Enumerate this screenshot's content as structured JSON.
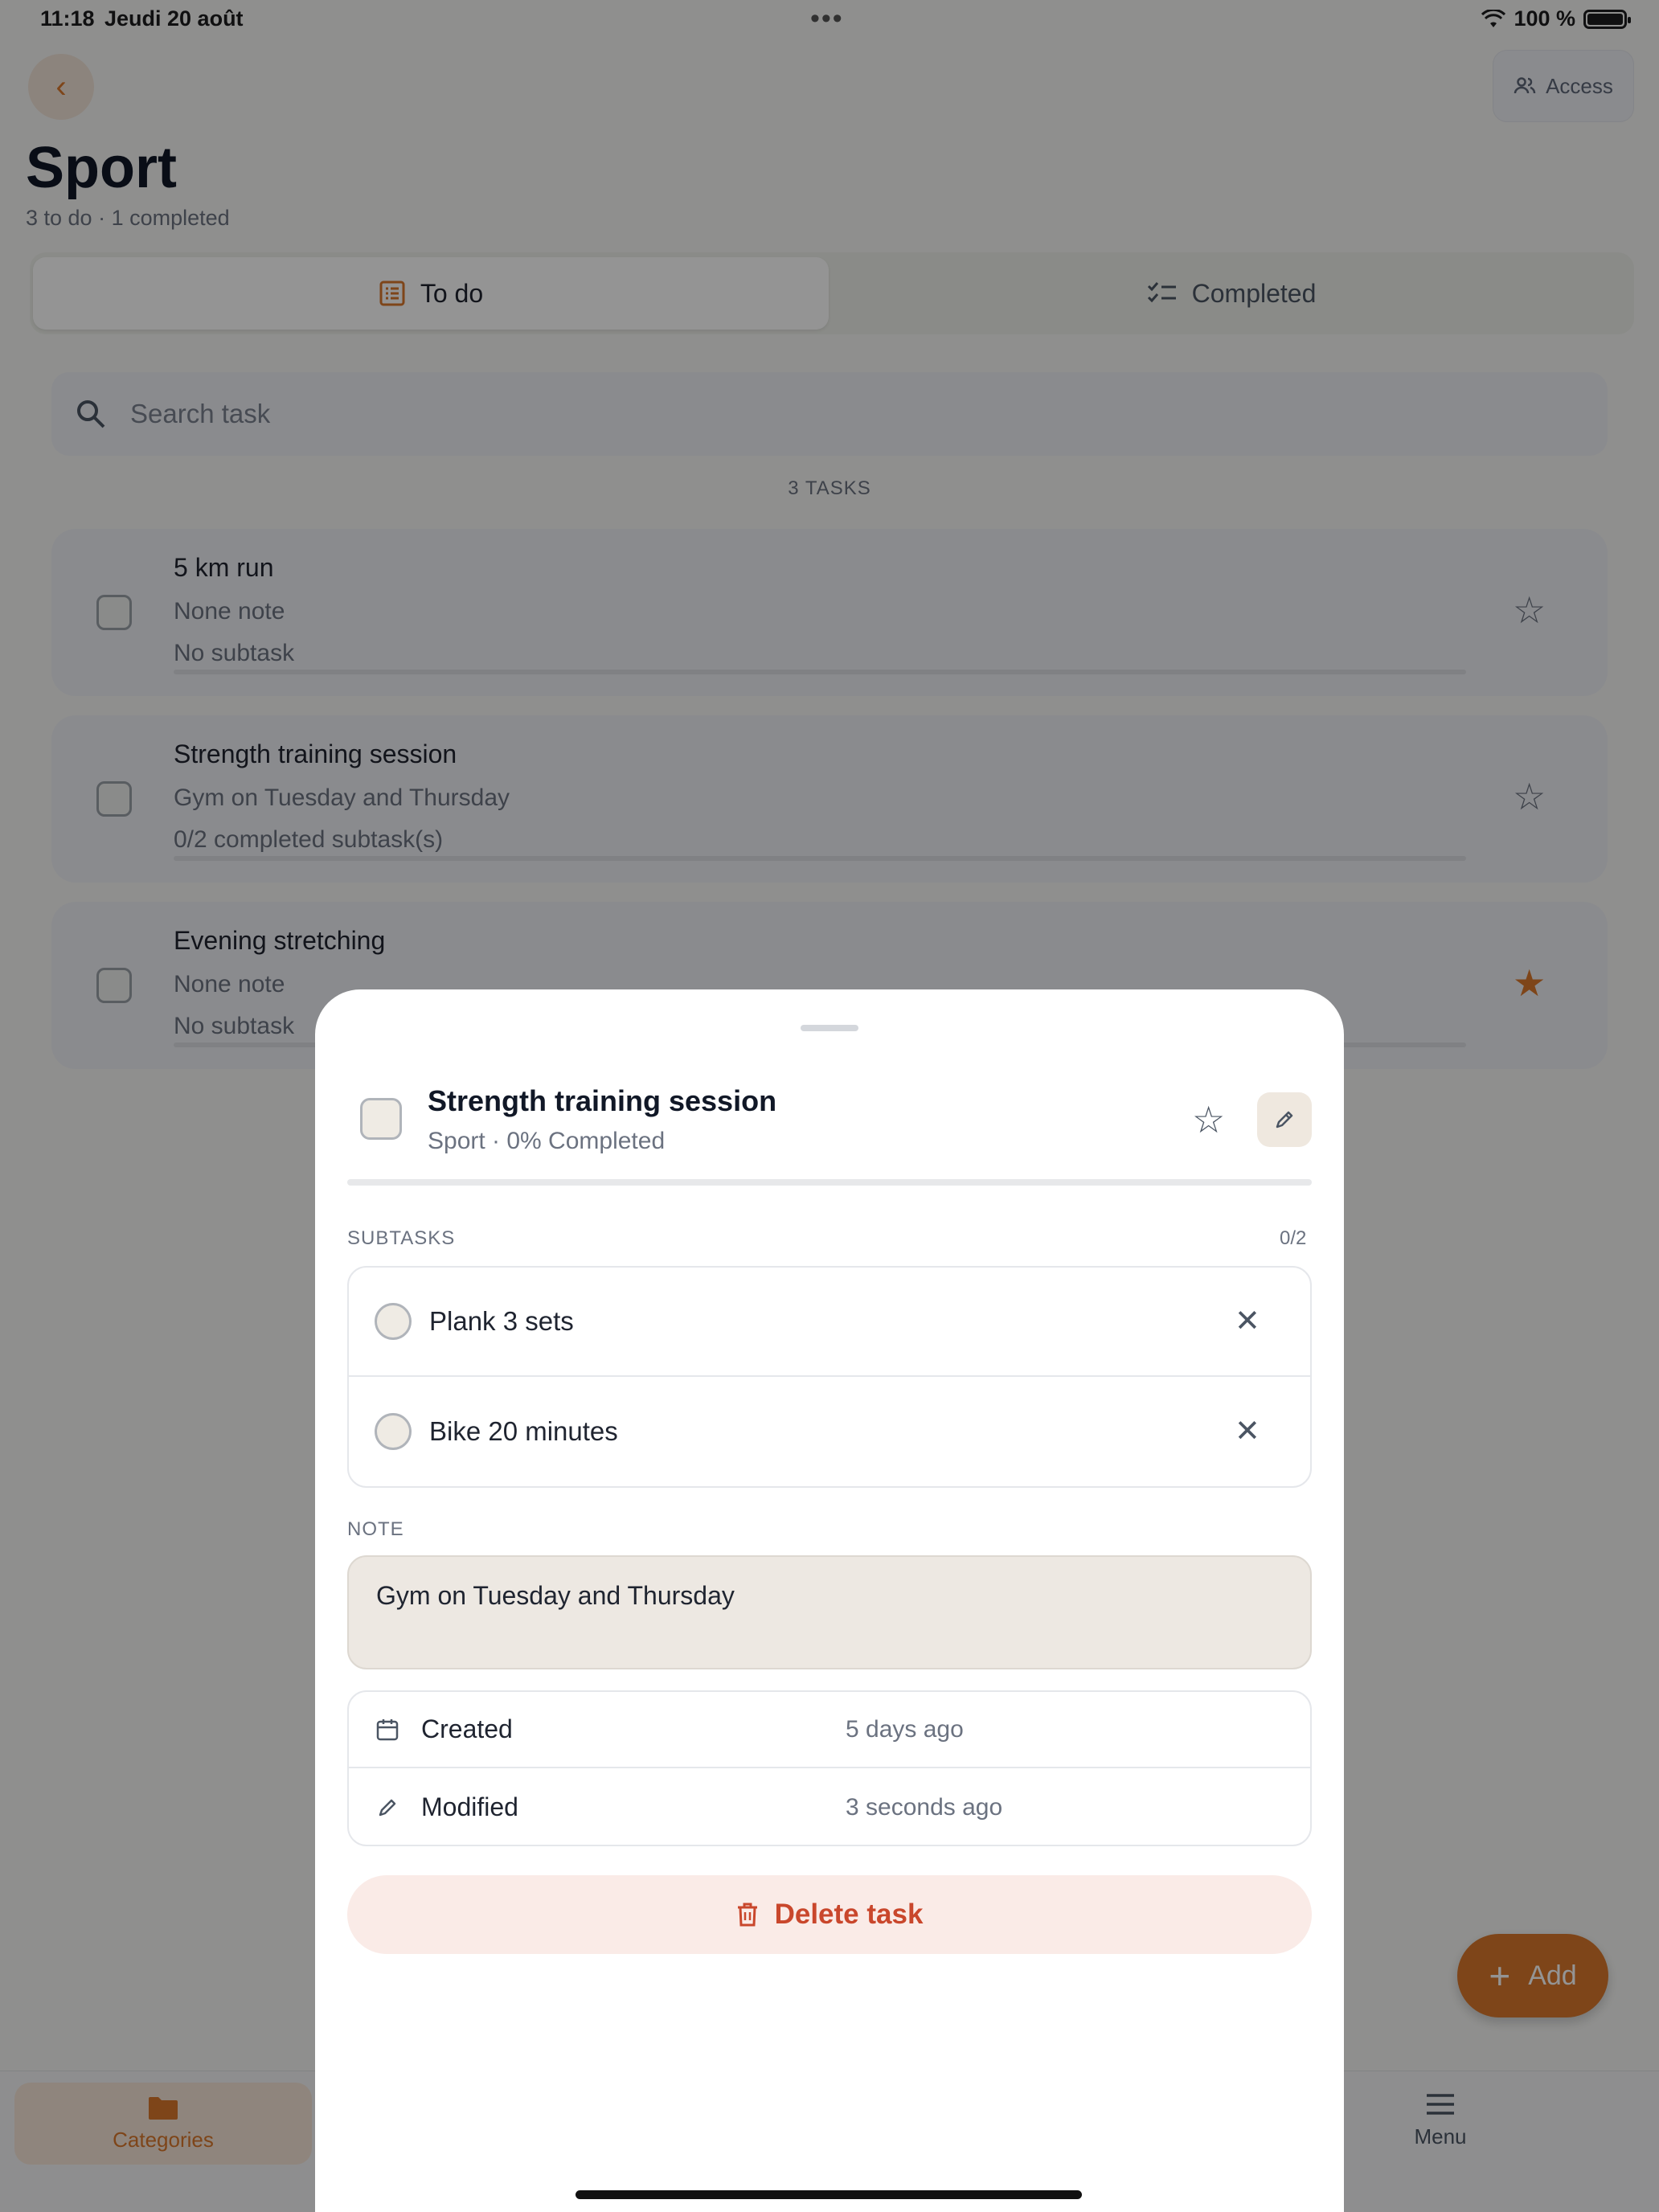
{
  "status": {
    "time": "11:18",
    "date": "Jeudi 20 août",
    "battery": "100 %"
  },
  "header": {
    "access_label": "Access",
    "title": "Sport",
    "subtitle": "3 to do · 1 completed"
  },
  "tabs": [
    {
      "label": "To do",
      "active": true
    },
    {
      "label": "Completed",
      "active": false
    }
  ],
  "search": {
    "placeholder": "Search task"
  },
  "list": {
    "count_label": "3 TASKS"
  },
  "tasks": [
    {
      "title": "5 km run",
      "note": "None note",
      "subtasks": "No subtask",
      "starred": false
    },
    {
      "title": "Strength training session",
      "note": "Gym on Tuesday and Thursday",
      "subtasks": "0/2 completed subtask(s)",
      "starred": false
    },
    {
      "title": "Evening stretching",
      "note": "None note",
      "subtasks": "No subtask",
      "starred": true
    }
  ],
  "fab": {
    "label": "Add"
  },
  "bottom_nav": {
    "categories_label": "Categories",
    "menu_label": "Menu"
  },
  "sheet": {
    "title": "Strength training session",
    "subtitle": "Sport · 0% Completed",
    "progress": 0,
    "subtasks_label": "SUBTASKS",
    "subtasks_count": "0/2",
    "subtasks": [
      {
        "label": "Plank 3 sets"
      },
      {
        "label": "Bike 20 minutes"
      }
    ],
    "note_label": "NOTE",
    "note": "Gym on Tuesday and Thursday",
    "meta": {
      "created_label": "Created",
      "created_value": "5 days ago",
      "modified_label": "Modified",
      "modified_value": "3 seconds ago"
    },
    "delete_label": "Delete task"
  },
  "colors": {
    "accent": "#d9772b",
    "danger": "#c9472c",
    "danger_bg": "#faebe7"
  }
}
